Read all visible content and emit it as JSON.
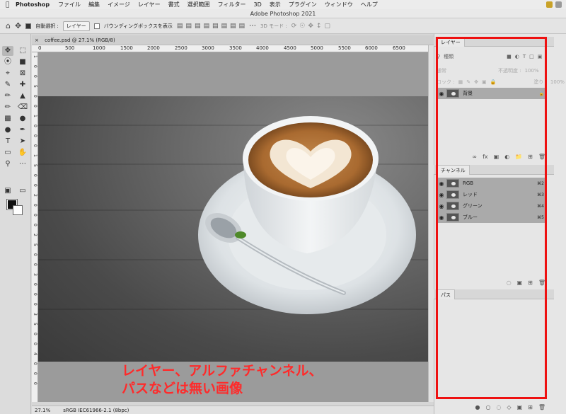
{
  "menubar": {
    "app_name": "Photoshop",
    "items": [
      "ファイル",
      "編集",
      "イメージ",
      "レイヤー",
      "書式",
      "選択範囲",
      "フィルター",
      "3D",
      "表示",
      "プラグイン",
      "ウィンドウ",
      "ヘルプ"
    ]
  },
  "window": {
    "title": "Adobe Photoshop 2021"
  },
  "options": {
    "auto_select_label": "自動選択 :",
    "auto_select_target": "レイヤー",
    "bounding_box_label": "バウンディングボックスを表示",
    "three_d_mode_label": "3D モード :"
  },
  "document": {
    "tab_label": "coffee.psd @ 27.1% (RGB/8)",
    "zoom": "27.1%",
    "color_profile": "sRGB IEC61966-2.1 (8bpc)"
  },
  "ruler": {
    "top_ticks": [
      "0",
      "500",
      "1000",
      "1500",
      "2000",
      "2500",
      "3000",
      "3500",
      "4000",
      "4500",
      "5000",
      "5500",
      "6000",
      "6500"
    ],
    "left_ticks": [
      "1",
      "0",
      "0",
      "5",
      "0",
      "0",
      "1",
      "0",
      "0",
      "0",
      "1",
      "5",
      "0",
      "0",
      "2",
      "0",
      "0",
      "0",
      "2",
      "5",
      "0",
      "0",
      "3",
      "0",
      "0",
      "0",
      "3",
      "5",
      "0",
      "0",
      "4",
      "0",
      "0",
      "0"
    ]
  },
  "layers_panel": {
    "tab": "レイヤー",
    "filter_kind": "種類",
    "blend_mode": "通常",
    "opacity_label": "不透明度 :",
    "opacity_value": "100%",
    "lock_label": "ロック :",
    "fill_label": "塗り :",
    "fill_value": "100%",
    "layers": [
      {
        "name": "背景"
      }
    ]
  },
  "channels_panel": {
    "tab": "チャンネル",
    "channels": [
      {
        "name": "RGB",
        "shortcut": "⌘2"
      },
      {
        "name": "レッド",
        "shortcut": "⌘3"
      },
      {
        "name": "グリーン",
        "shortcut": "⌘4"
      },
      {
        "name": "ブルー",
        "shortcut": "⌘5"
      }
    ]
  },
  "paths_panel": {
    "tab": "パス"
  },
  "annotation": {
    "line1": "レイヤー、アルファチャンネル、",
    "line2": "パスなどは無い画像"
  },
  "colors": {
    "annotation": "#ff2a2a",
    "highlight_box": "#ee1111"
  }
}
